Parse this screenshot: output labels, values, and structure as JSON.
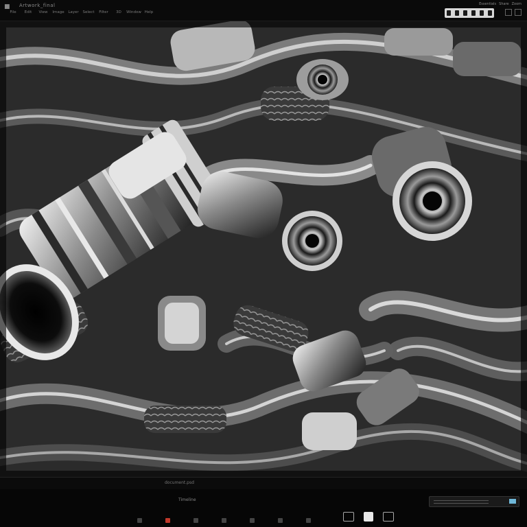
{
  "topbar": {
    "app_title": "Artwork_final",
    "menu": [
      "File",
      "Edit",
      "View",
      "Image",
      "Layer",
      "Select",
      "Filter",
      "3D",
      "Window",
      "Help"
    ],
    "right_labels": [
      "Essentials",
      "Share",
      "Zoom"
    ]
  },
  "statusbar": {
    "file_name": "document.psd"
  },
  "bottombar": {
    "mid_label": "Timeline"
  },
  "colors": {
    "accent": "#6fb7d8",
    "alert": "#c0392b",
    "background": "#050505"
  }
}
